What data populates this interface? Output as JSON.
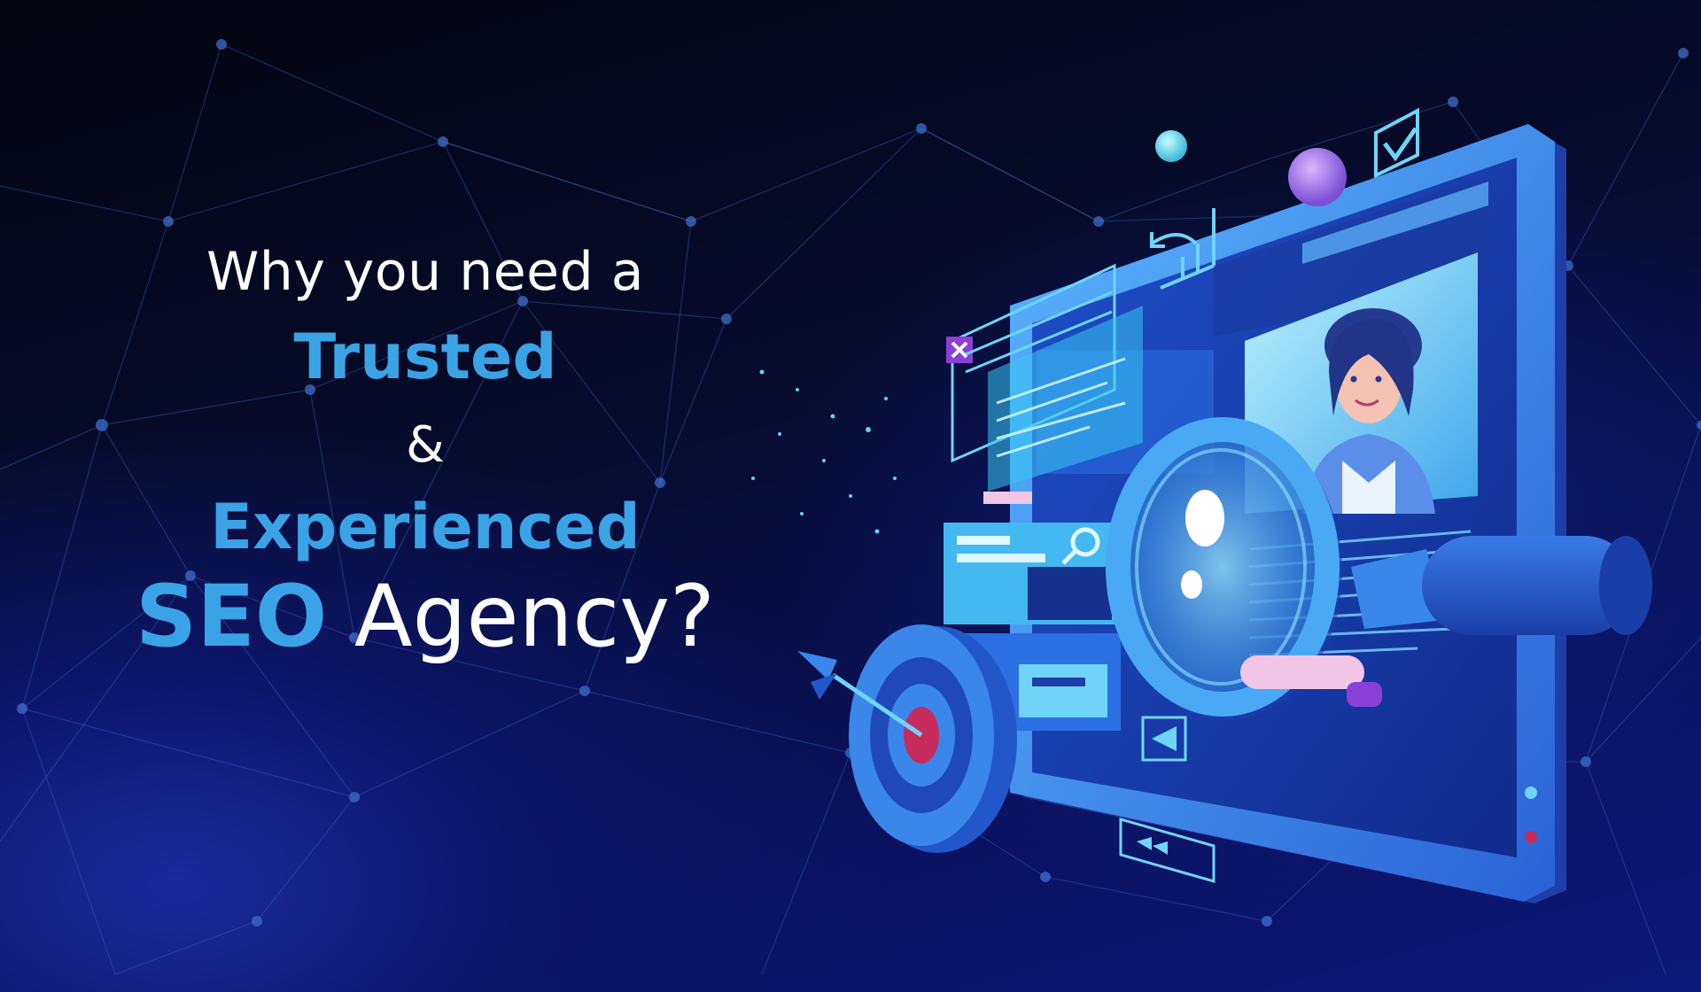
{
  "headline": {
    "line1": "Why you need a",
    "line2": "Trusted",
    "line3": "&",
    "line4": "Experienced",
    "line5_keyword": "SEO",
    "line5_rest": "Agency?"
  },
  "colors": {
    "accent_blue": "#3aa3e6",
    "text_white": "#ffffff",
    "background_dark": "#050a24",
    "background_blue": "#0e1877",
    "screen_frame": "#3b8be8",
    "target_red": "#c72b5b",
    "highlight_pink": "#f1c6e6",
    "purple_accent": "#8a3fd8"
  },
  "illustration": {
    "icons": [
      "monitor-icon",
      "magnifying-glass-icon",
      "target-icon",
      "arrow-icon",
      "checkbox-icon",
      "close-icon",
      "chart-icon",
      "search-icon",
      "rewind-icon",
      "play-back-icon",
      "person-avatar-icon"
    ]
  }
}
